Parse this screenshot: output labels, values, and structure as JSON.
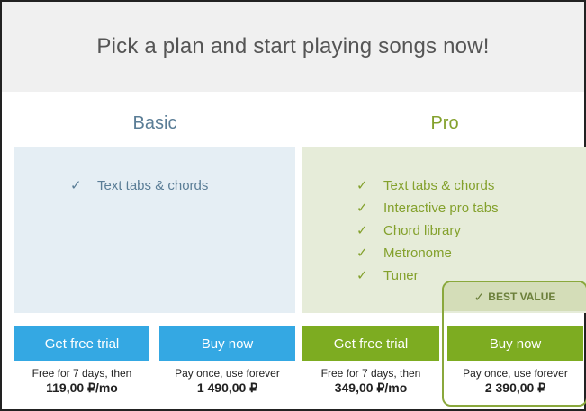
{
  "header": {
    "title": "Pick a plan and start playing songs now!"
  },
  "plans": {
    "basic": {
      "name": "Basic",
      "features": [
        "Text tabs & chords"
      ],
      "trial_button": "Get free trial",
      "buy_button": "Buy now",
      "trial_note": "Free for 7 days, then",
      "trial_price": "119,00 ₽/mo",
      "buy_note": "Pay once, use forever",
      "buy_price": "1 490,00 ₽"
    },
    "pro": {
      "name": "Pro",
      "features": [
        "Text tabs & chords",
        "Interactive pro tabs",
        "Chord library",
        "Metronome",
        "Tuner"
      ],
      "trial_button": "Get free trial",
      "buy_button": "Buy now",
      "trial_note": "Free for 7 days, then",
      "trial_price": "349,00 ₽/mo",
      "buy_note": "Pay once, use forever",
      "buy_price": "2 390,00 ₽",
      "badge": "BEST VALUE"
    }
  },
  "icons": {
    "check": "checkmark-icon"
  },
  "colors": {
    "header_bg": "#f0f0f0",
    "basic_accent": "#5a7d96",
    "pro_accent": "#84a12d",
    "blue_button": "#34a8e3",
    "green_button": "#7dac21"
  }
}
